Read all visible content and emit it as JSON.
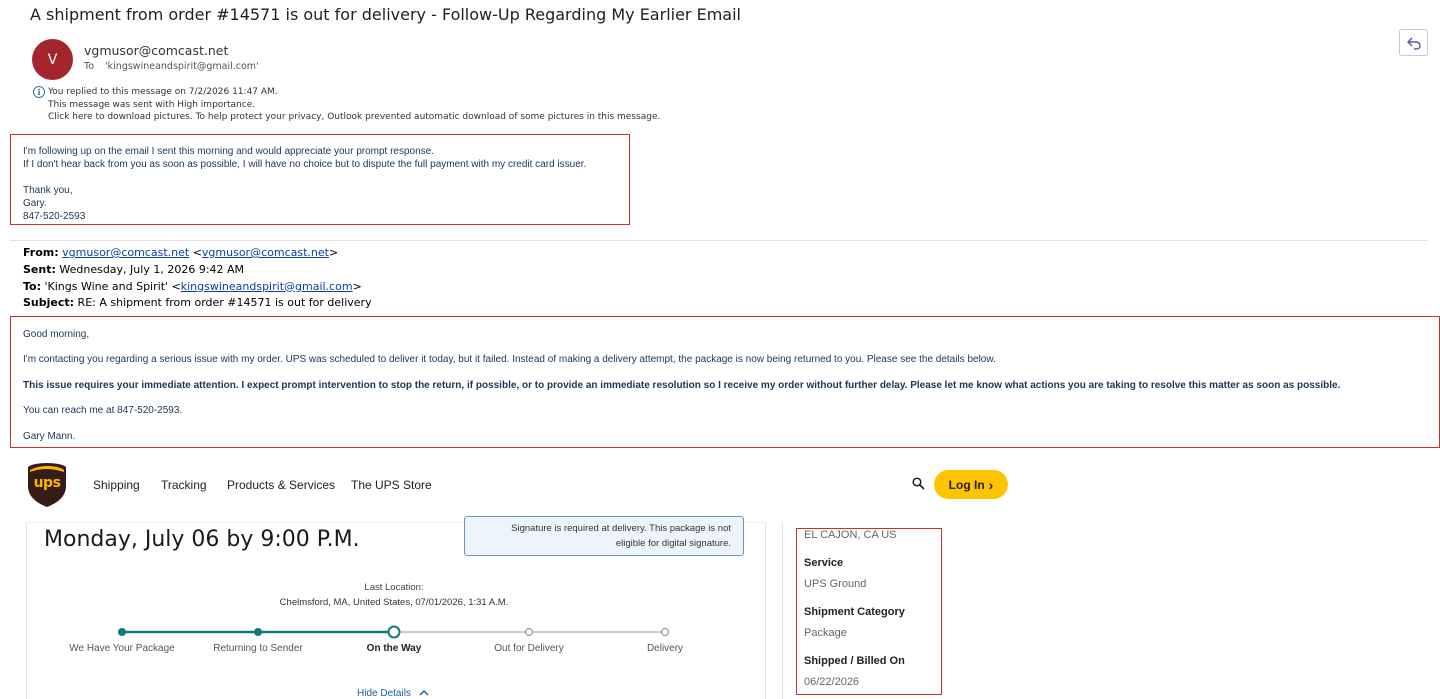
{
  "email": {
    "subject": "A shipment from order #14571 is out for delivery - Follow-Up Regarding My Earlier Email",
    "avatar_initial": "V",
    "sender": "vgmusor@comcast.net",
    "to_label": "To",
    "to_value": "'kingswineandspirit@gmail.com'",
    "info_lines": [
      "You replied to this message on 7/2/2026 11:47 AM.",
      "This message was sent with High importance.",
      "Click here to download pictures. To help protect your privacy, Outlook prevented automatic download of some pictures in this message."
    ],
    "followup_body": [
      "I'm following up on the email I sent this morning and would appreciate your prompt response.",
      "If I don't hear back from you as soon as possible, I will have no choice but to dispute the full payment with my credit card issuer.",
      "",
      "Thank you,",
      "Gary.",
      "847-520-2593"
    ],
    "quoted_header": {
      "from_label": "From:",
      "from_link": "vgmusor@comcast.net",
      "from_angle_open": "<",
      "from_angle_link": "vgmusor@comcast.net",
      "from_angle_close": ">",
      "sent_label": "Sent:",
      "sent_value": "Wednesday, July 1, 2026 9:42 AM",
      "to_label": "To:",
      "to_value": "'Kings Wine and Spirit' <",
      "to_link": "kingswineandspirit@gmail.com",
      "to_close": ">",
      "subject_label": "Subject:",
      "subject_value": "RE: A shipment from order #14571 is out for delivery"
    },
    "original_body": {
      "greeting": "Good morning,",
      "para1": "I'm contacting you regarding a serious issue with my order. UPS was scheduled to deliver it today, but it failed. Instead of making a delivery attempt, the package is now being returned to you. Please see the details below.",
      "para2": "This issue requires your immediate attention. I expect prompt intervention to stop the return, if possible, or to provide an immediate resolution so I receive my order without further delay. Please let me know what actions you are taking to resolve this matter as soon as possible.",
      "para3": "You can reach me at 847-520-2593.",
      "signature": "Gary Mann."
    }
  },
  "ups": {
    "logo_text": "UPS",
    "nav": [
      "Shipping",
      "Tracking",
      "Products & Services",
      "The UPS Store"
    ],
    "login_label": "Log In",
    "login_arrow": "›",
    "note_lines": [
      "Signature is required at delivery. This package is not",
      "eligible for digital signature."
    ],
    "delivery_date": "Monday, July 06 by 9:00 P.M.",
    "last_location_label": "Last Location:",
    "last_location_value": "Chelmsford, MA, United States, 07/01/2026, 1:31 A.M.",
    "steps": [
      "We Have Your Package",
      "Returning to Sender",
      "On the Way",
      "Out for Delivery",
      "Delivery"
    ],
    "current_step_index": 2,
    "hide_details": "Hide Details",
    "side": {
      "location": "EL CAJON, CA US",
      "service_label": "Service",
      "service_value": "UPS Ground",
      "category_label": "Shipment Category",
      "category_value": "Package",
      "shipped_label": "Shipped / Billed On",
      "shipped_value": "06/22/2026"
    },
    "colors": {
      "brown": "#351c15",
      "gold": "#ffc400",
      "progress": "#0f7a7a"
    }
  }
}
